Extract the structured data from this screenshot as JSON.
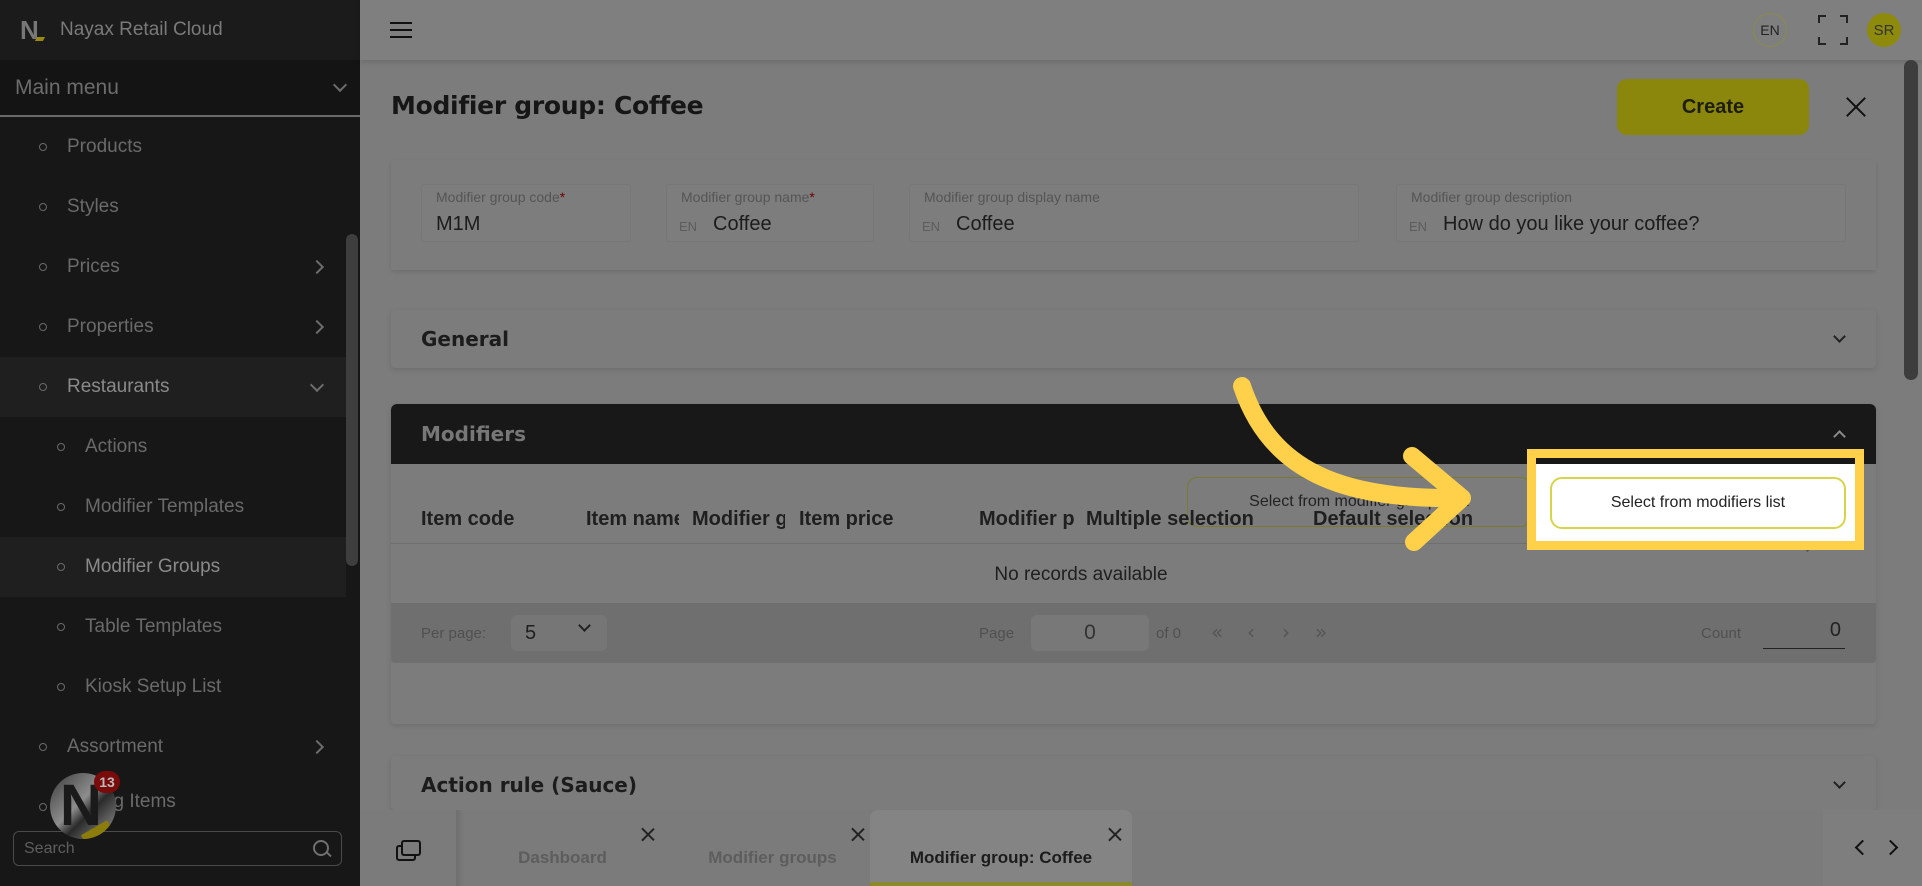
{
  "app": {
    "title": "Nayax Retail Cloud",
    "main_menu_label": "Main menu"
  },
  "sidebar": {
    "items": [
      {
        "label": "Products",
        "level": 1,
        "has_children": false
      },
      {
        "label": "Styles",
        "level": 1,
        "has_children": false
      },
      {
        "label": "Prices",
        "level": 1,
        "has_children": true
      },
      {
        "label": "Properties",
        "level": 1,
        "has_children": true
      },
      {
        "label": "Restaurants",
        "level": 1,
        "has_children": true,
        "expanded": true
      },
      {
        "label": "Actions",
        "level": 2
      },
      {
        "label": "Modifier Templates",
        "level": 2
      },
      {
        "label": "Modifier Groups",
        "level": 2,
        "active": true
      },
      {
        "label": "Table Templates",
        "level": 2
      },
      {
        "label": "Kiosk Setup List",
        "level": 2
      },
      {
        "label": "Assortment",
        "level": 1,
        "has_children": true
      },
      {
        "label": "Selling Items",
        "level": 1,
        "has_children": false
      }
    ],
    "search_placeholder": "Search",
    "notification_count": "13"
  },
  "topbar": {
    "language": "EN",
    "user_initials": "SR"
  },
  "page": {
    "title": "Modifier group: Coffee",
    "create_label": "Create",
    "fields": {
      "code": {
        "label": "Modifier group code",
        "required": "*",
        "value": "M1M"
      },
      "name": {
        "label": "Modifier group name",
        "required": "*",
        "lang": "EN",
        "value": "Coffee"
      },
      "display_name": {
        "label": "Modifier group display name",
        "lang": "EN",
        "value": "Coffee"
      },
      "description": {
        "label": "Modifier group description",
        "lang": "EN",
        "value": "How do you like your coffee?"
      }
    },
    "sections": {
      "general": "General",
      "modifiers": "Modifiers",
      "action_rule": "Action rule (Sauce)"
    },
    "modifiers": {
      "select_groups_label": "Select from modifier groups list",
      "select_modifiers_label": "Select from modifiers list",
      "columns": [
        "Item code",
        "Item name",
        "Modifier group",
        "Item price",
        "Modifier price",
        "Multiple selection",
        "Default selection"
      ],
      "empty_text": "No records available",
      "pager": {
        "per_page_label": "Per page:",
        "per_page_value": "5",
        "page_label": "Page",
        "page_value": "0",
        "of_label": "of 0",
        "first": "«",
        "prev": "‹",
        "next": "›",
        "last": "»",
        "count_label": "Count",
        "count_value": "0"
      }
    }
  },
  "tabs": [
    {
      "label": "Dashboard",
      "active": false
    },
    {
      "label": "Modifier groups",
      "active": false
    },
    {
      "label": "Modifier group: Coffee",
      "active": true
    }
  ],
  "colors": {
    "accent": "#e6e20e",
    "highlight": "#ffd04a",
    "sidebar_bg": "#171717",
    "notification": "#c3111b"
  }
}
